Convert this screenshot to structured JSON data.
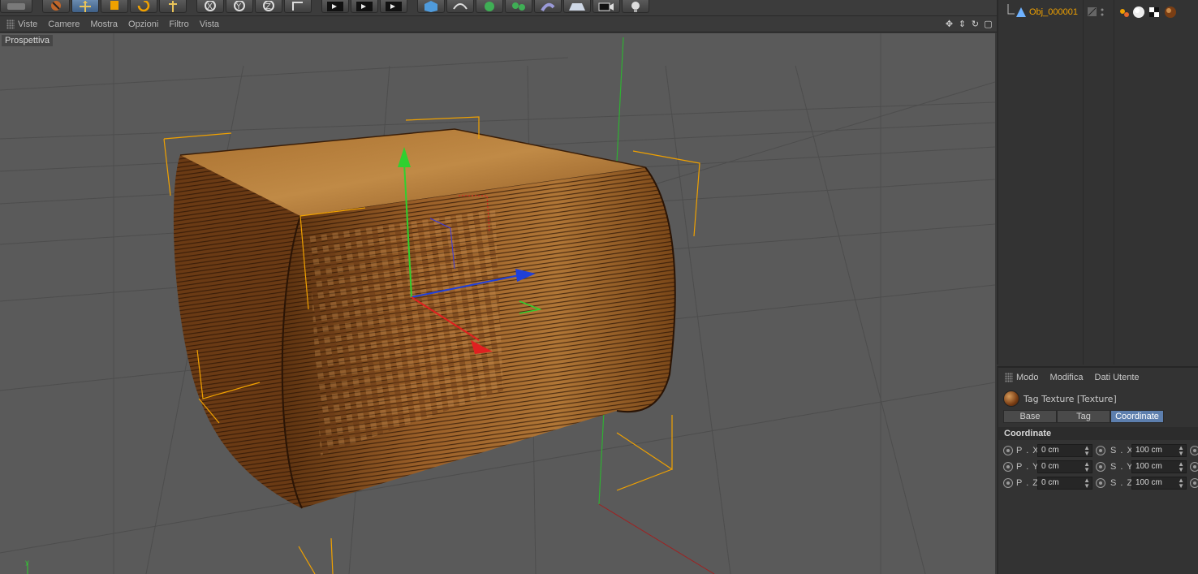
{
  "viewport_menu": {
    "items": [
      "Viste",
      "Camere",
      "Mostra",
      "Opzioni",
      "Filtro",
      "Vista"
    ]
  },
  "viewport": {
    "label": "Prospettiva"
  },
  "object_manager": {
    "object_name": "Obj_000001"
  },
  "attributes": {
    "menu": [
      "Modo",
      "Modifica",
      "Dati Utente"
    ],
    "tag_title": "Tag Texture [Texture]",
    "tabs": [
      "Base",
      "Tag",
      "Coordinate"
    ],
    "active_tab": "Coordinate",
    "section": "Coordinate",
    "rows": [
      {
        "p_label": "P . X",
        "p_value": "0 cm",
        "s_label": "S . X",
        "s_value": "100 cm"
      },
      {
        "p_label": "P . Y",
        "p_value": "0 cm",
        "s_label": "S . Y",
        "s_value": "100 cm"
      },
      {
        "p_label": "P . Z",
        "p_value": "0 cm",
        "s_label": "S . Z",
        "s_value": "100 cm"
      }
    ]
  },
  "colors": {
    "accent": "#f0a100",
    "active_tab": "#5d7fae",
    "viewport_bg": "#5a5a5a",
    "wood": "#a0642a"
  },
  "toolbar_icons": [
    "undo-icon",
    "move-icon",
    "scale-icon",
    "rotate-icon",
    "select-icon",
    "x-axis-icon",
    "y-axis-icon",
    "z-axis-icon",
    "coord-system-icon",
    "render-view-icon",
    "render-picture-icon",
    "render-settings-icon",
    "cube-icon",
    "spline-icon",
    "nurbs-icon",
    "array-icon",
    "deformer-icon",
    "floor-icon",
    "camera-icon",
    "light-icon"
  ]
}
